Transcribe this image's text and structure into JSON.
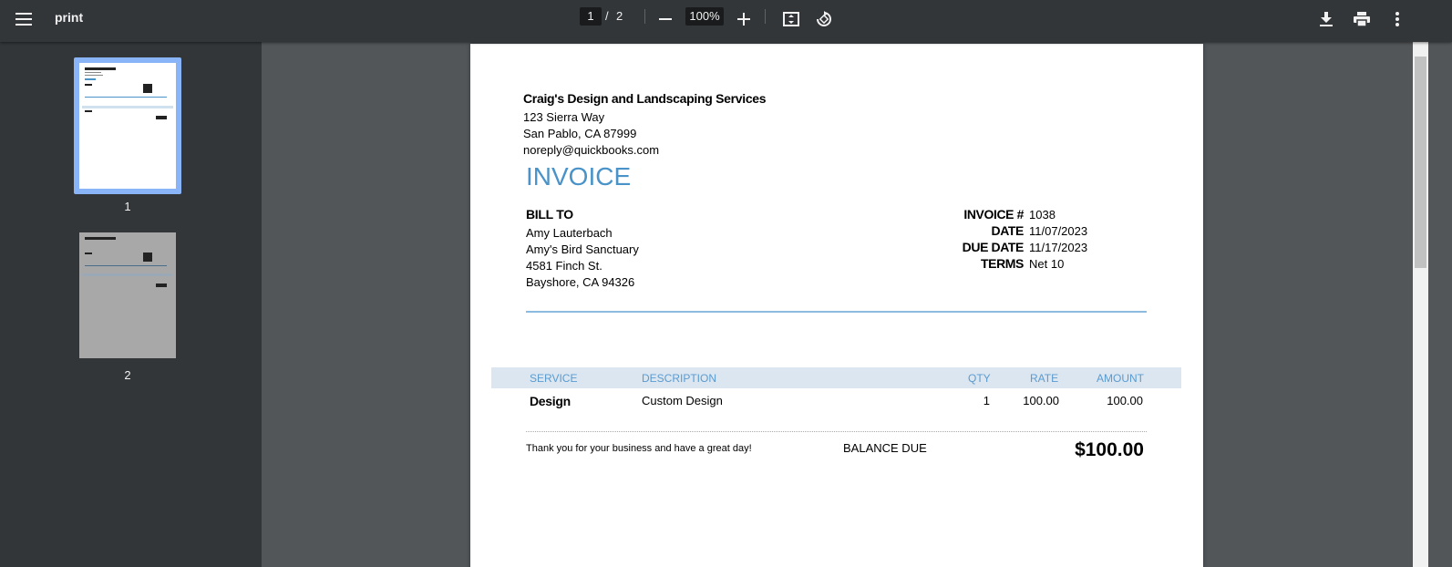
{
  "toolbar": {
    "title": "print",
    "current_page": "1",
    "page_separator": "/",
    "total_pages": "2",
    "zoom": "100%",
    "icons": [
      "menu-icon",
      "zoom-out-icon",
      "zoom-in-icon",
      "fit-page-icon",
      "rotate-icon",
      "download-icon",
      "print-icon",
      "more-options-icon"
    ]
  },
  "sidebar": {
    "thumbnails": [
      {
        "label": "1",
        "selected": true
      },
      {
        "label": "2",
        "selected": false
      }
    ],
    "selected_color": "#8ab4f8"
  },
  "invoice": {
    "company": "Craig's Design and Landscaping Services",
    "address": [
      "123 Sierra Way",
      "San Pablo, CA  87999",
      "noreply@quickbooks.com"
    ],
    "title": "INVOICE",
    "accent_color": "#4a93c9",
    "bill_to_label": "BILL TO",
    "bill_to": [
      "Amy Lauterbach",
      "Amy's Bird Sanctuary",
      "4581 Finch St.",
      "Bayshore, CA  94326"
    ],
    "meta": [
      {
        "label": "INVOICE #",
        "value": "1038"
      },
      {
        "label": "DATE",
        "value": "11/07/2023"
      },
      {
        "label": "DUE DATE",
        "value": "11/17/2023"
      },
      {
        "label": "TERMS",
        "value": "Net 10"
      }
    ],
    "columns": [
      "SERVICE",
      "DESCRIPTION",
      "QTY",
      "RATE",
      "AMOUNT"
    ],
    "rows": [
      {
        "service": "Design",
        "description": "Custom Design",
        "qty": "1",
        "rate": "100.00",
        "amount": "100.00"
      }
    ],
    "thanks": "Thank you for your business and have a great day!",
    "balance_label": "BALANCE DUE",
    "balance_amount": "$100.00"
  }
}
